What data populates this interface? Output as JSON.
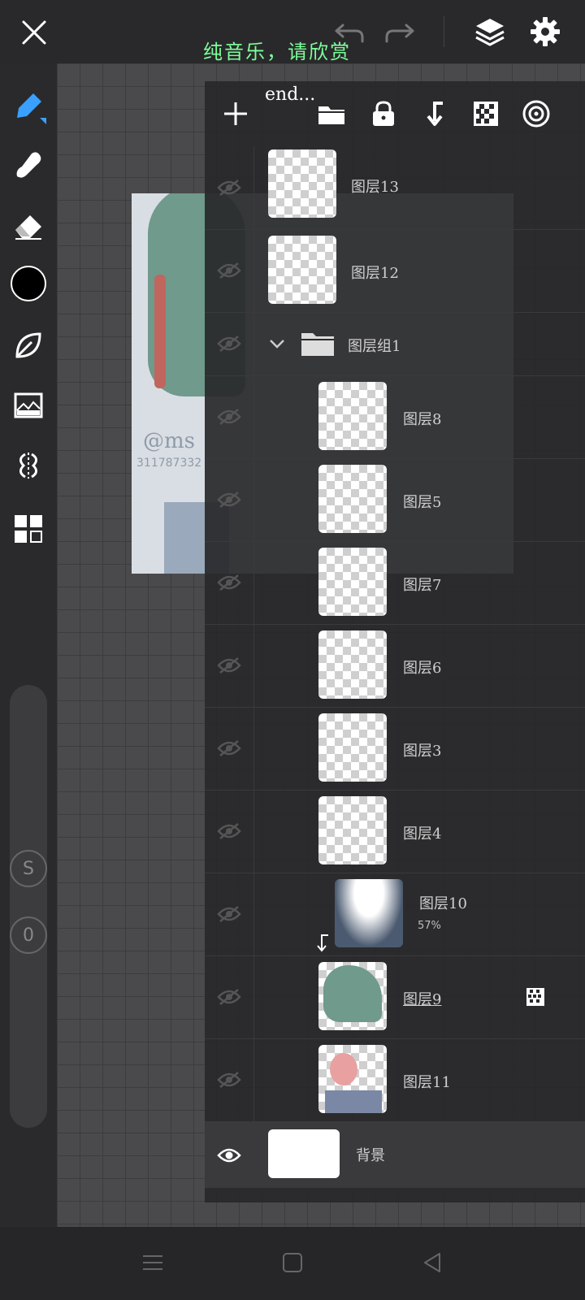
{
  "topbar": {
    "overlay_text": "纯音乐，请欣赏"
  },
  "panel": {
    "overlay_text": "end..."
  },
  "layers": [
    {
      "name": "图层13"
    },
    {
      "name": "图层12"
    },
    {
      "name": "图层组1"
    },
    {
      "name": "图层8"
    },
    {
      "name": "图层5"
    },
    {
      "name": "图层7"
    },
    {
      "name": "图层6"
    },
    {
      "name": "图层3"
    },
    {
      "name": "图层4"
    },
    {
      "name": "图层10",
      "opacity": "57%"
    },
    {
      "name": "图层9"
    },
    {
      "name": "图层11"
    },
    {
      "name": "背景"
    }
  ],
  "sidebar": {
    "s_label": "S",
    "o_label": "0"
  },
  "art": {
    "watermark_handle": "@ms",
    "watermark_number": "311787332"
  },
  "colors": {
    "current_color": "#000000",
    "accent": "#3aa0ff",
    "overlay_text": "#7dff9a"
  }
}
